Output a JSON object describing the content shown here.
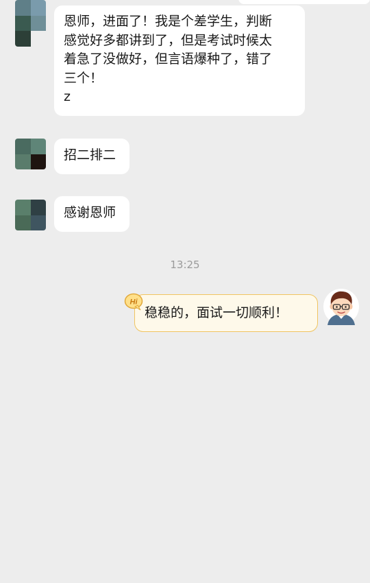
{
  "messages": [
    {
      "text": "恩师，进面了！我是个差学生，判断\n感觉好多都讲到了，但是考试时候太\n着急了没做好，但言语爆种了，错了\n三个！\nz"
    },
    {
      "text": "招二排二"
    },
    {
      "text": "感谢恩师"
    }
  ],
  "timestamp": "13:25",
  "sent_message": {
    "text": "稳稳的，面试一切顺利！",
    "badge": "Hi"
  },
  "colors": {
    "background": "#ededed",
    "bubble": "#ffffff",
    "sent_bubble": "#fef9ea",
    "sent_border": "#f0c45f",
    "timestamp": "#9a9a9a"
  },
  "icons": {
    "badge": "hi-badge-icon",
    "my_avatar": "cartoon-glasses-man-avatar"
  }
}
